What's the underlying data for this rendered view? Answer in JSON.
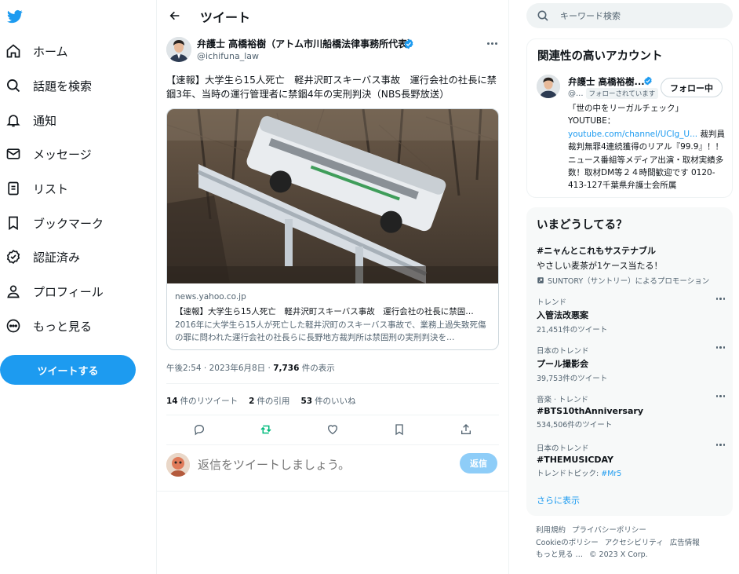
{
  "nav": {
    "items": [
      {
        "label": "ホーム",
        "icon": "home-icon"
      },
      {
        "label": "話題を検索",
        "icon": "search-icon"
      },
      {
        "label": "通知",
        "icon": "bell-icon"
      },
      {
        "label": "メッセージ",
        "icon": "mail-icon"
      },
      {
        "label": "リスト",
        "icon": "list-icon"
      },
      {
        "label": "ブックマーク",
        "icon": "bookmark-icon"
      },
      {
        "label": "認証済み",
        "icon": "verified-icon"
      },
      {
        "label": "プロフィール",
        "icon": "person-icon"
      },
      {
        "label": "もっと見る",
        "icon": "more-circle-icon"
      }
    ],
    "tweet_button": "ツイートする"
  },
  "main": {
    "header_title": "ツイート",
    "author": {
      "name": "弁護士 高橋裕樹（アトム市川船橋法律事務所代表）",
      "handle": "@ichifuna_law"
    },
    "text": "【速報】大学生ら15人死亡　軽井沢町スキーバス事故　運行会社の社長に禁錮3年、当時の運行管理者に禁錮4年の実刑判決（NBS長野放送）",
    "card": {
      "domain": "news.yahoo.co.jp",
      "title": "【速報】大学生ら15人死亡　軽井沢町スキーバス事故　運行会社の社長に禁固…",
      "description": "2016年に大学生ら15人が死亡した軽井沢町のスキーバス事故で、業務上過失致死傷の罪に問われた運行会社の社長らに長野地方裁判所は禁固刑の実刑判決を…"
    },
    "meta": {
      "time": "午後2:54 · 2023年6月8日 · ",
      "views": "7,736",
      "views_label": " 件の表示"
    },
    "stats": {
      "retweets": "14",
      "retweets_label": "件のリツイート",
      "quotes": "2",
      "quotes_label": "件の引用",
      "likes": "53",
      "likes_label": "件のいいね"
    },
    "reply": {
      "placeholder": "返信をツイートしましょう。",
      "button": "返信"
    }
  },
  "right": {
    "search_placeholder": "キーワード検索",
    "related": {
      "heading": "関連性の高いアカウント",
      "name": "弁護士 高橋裕樹...",
      "handle": "@...",
      "follows_you": "フォローされています",
      "follow_button": "フォロー中",
      "bio_1": "「世の中をリーガルチェック」YOUTUBE：",
      "bio_link": "youtube.com/channel/UClg_U...",
      "bio_2": " 裁判員裁判無罪4連続獲得のリアル『99.9』！！ ニュース番組等メディア出演・取材実績多数！取材DM等２４時間歓迎です 0120-413-127千葉県弁護士会所属"
    },
    "trends": {
      "heading": "いまどうしてる？",
      "promo": {
        "title": "#ニャんとこれもサステナブル",
        "desc": "やさしい麦茶が1ケース当たる！",
        "by": "SUNTORY（サントリー）によるプロモーション"
      },
      "items": [
        {
          "context": "トレンド",
          "title": "入管法改悪案",
          "count": "21,451件のツイート"
        },
        {
          "context": "日本のトレンド",
          "title": "プール撮影会",
          "count": "39,753件のツイート"
        },
        {
          "context": "音楽 · トレンド",
          "title": "#BTS10thAnniversary",
          "count": "534,506件のツイート"
        },
        {
          "context": "日本のトレンド",
          "title": "#THEMUSICDAY",
          "count": "トレンドトピック: ",
          "count_link": "#Mr5"
        }
      ],
      "show_more": "さらに表示"
    },
    "footer": {
      "terms": "利用規約",
      "privacy": "プライバシーポリシー",
      "cookie": "Cookieのポリシー",
      "accessibility": "アクセシビリティ",
      "ads": "広告情報",
      "more": "もっと見る …",
      "copyright": "© 2023 X Corp."
    }
  },
  "colors": {
    "accent": "#1d9bf0",
    "text": "#0f1419",
    "muted": "#536471",
    "retweet_active": "#00ba7c"
  }
}
